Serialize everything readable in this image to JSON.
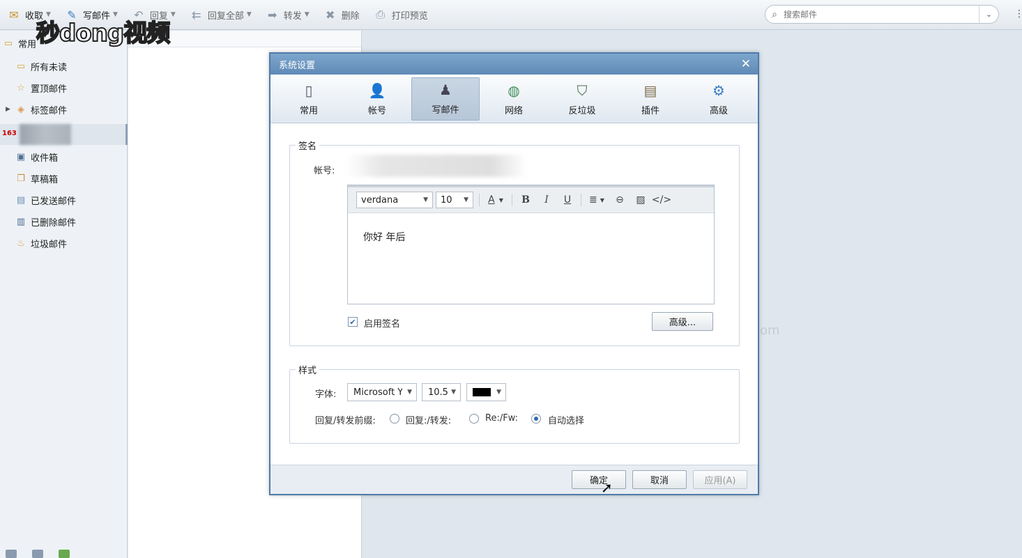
{
  "toolbar": {
    "receive": "收取",
    "compose": "写邮件",
    "reply": "回复",
    "reply_all": "回复全部",
    "forward": "转发",
    "delete": "删除",
    "print_preview": "打印预览"
  },
  "search": {
    "placeholder": "搜索邮件"
  },
  "watermark": "秒dong视频",
  "sidebar": {
    "folder_group": "常用",
    "items": [
      {
        "label": "所有未读",
        "icon": "folder-icon"
      },
      {
        "label": "置顶邮件",
        "icon": "star-icon"
      },
      {
        "label": "标签邮件",
        "icon": "tag-icon"
      }
    ],
    "account_badge": "163",
    "mailboxes": [
      {
        "label": "收件箱",
        "icon": "inbox-icon"
      },
      {
        "label": "草稿箱",
        "icon": "draft-icon"
      },
      {
        "label": "已发送邮件",
        "icon": "sent-icon"
      },
      {
        "label": "已删除邮件",
        "icon": "trash-icon"
      },
      {
        "label": "垃圾邮件",
        "icon": "spam-icon"
      }
    ]
  },
  "reading_pane": {
    "fragment": "om"
  },
  "dialog": {
    "title": "系统设置",
    "tabs": [
      {
        "label": "常用",
        "icon": "general-icon"
      },
      {
        "label": "帐号",
        "icon": "account-icon"
      },
      {
        "label": "写邮件",
        "icon": "compose-icon",
        "active": true
      },
      {
        "label": "网络",
        "icon": "globe-icon"
      },
      {
        "label": "反垃圾",
        "icon": "shield-icon"
      },
      {
        "label": "插件",
        "icon": "plugin-icon"
      },
      {
        "label": "高级",
        "icon": "gear-icon"
      }
    ],
    "signature": {
      "legend": "签名",
      "account_label": "帐号:",
      "font_family": "verdana",
      "font_size": "10",
      "content": "你好 年后",
      "enable_label": "启用签名",
      "enabled": true,
      "advanced_button": "高级..."
    },
    "style": {
      "legend": "样式",
      "font_label": "字体:",
      "font_family": "Microsoft Y",
      "font_size": "10.5",
      "color": "#000000",
      "prefix_label": "回复/转发前缀:",
      "prefix_options": [
        {
          "label": "回复:/转发:",
          "selected": false
        },
        {
          "label": "Re:/Fw:",
          "selected": false
        },
        {
          "label": "自动选择",
          "selected": true
        }
      ]
    },
    "buttons": {
      "ok": "确定",
      "cancel": "取消",
      "apply": "应用(A)"
    }
  }
}
